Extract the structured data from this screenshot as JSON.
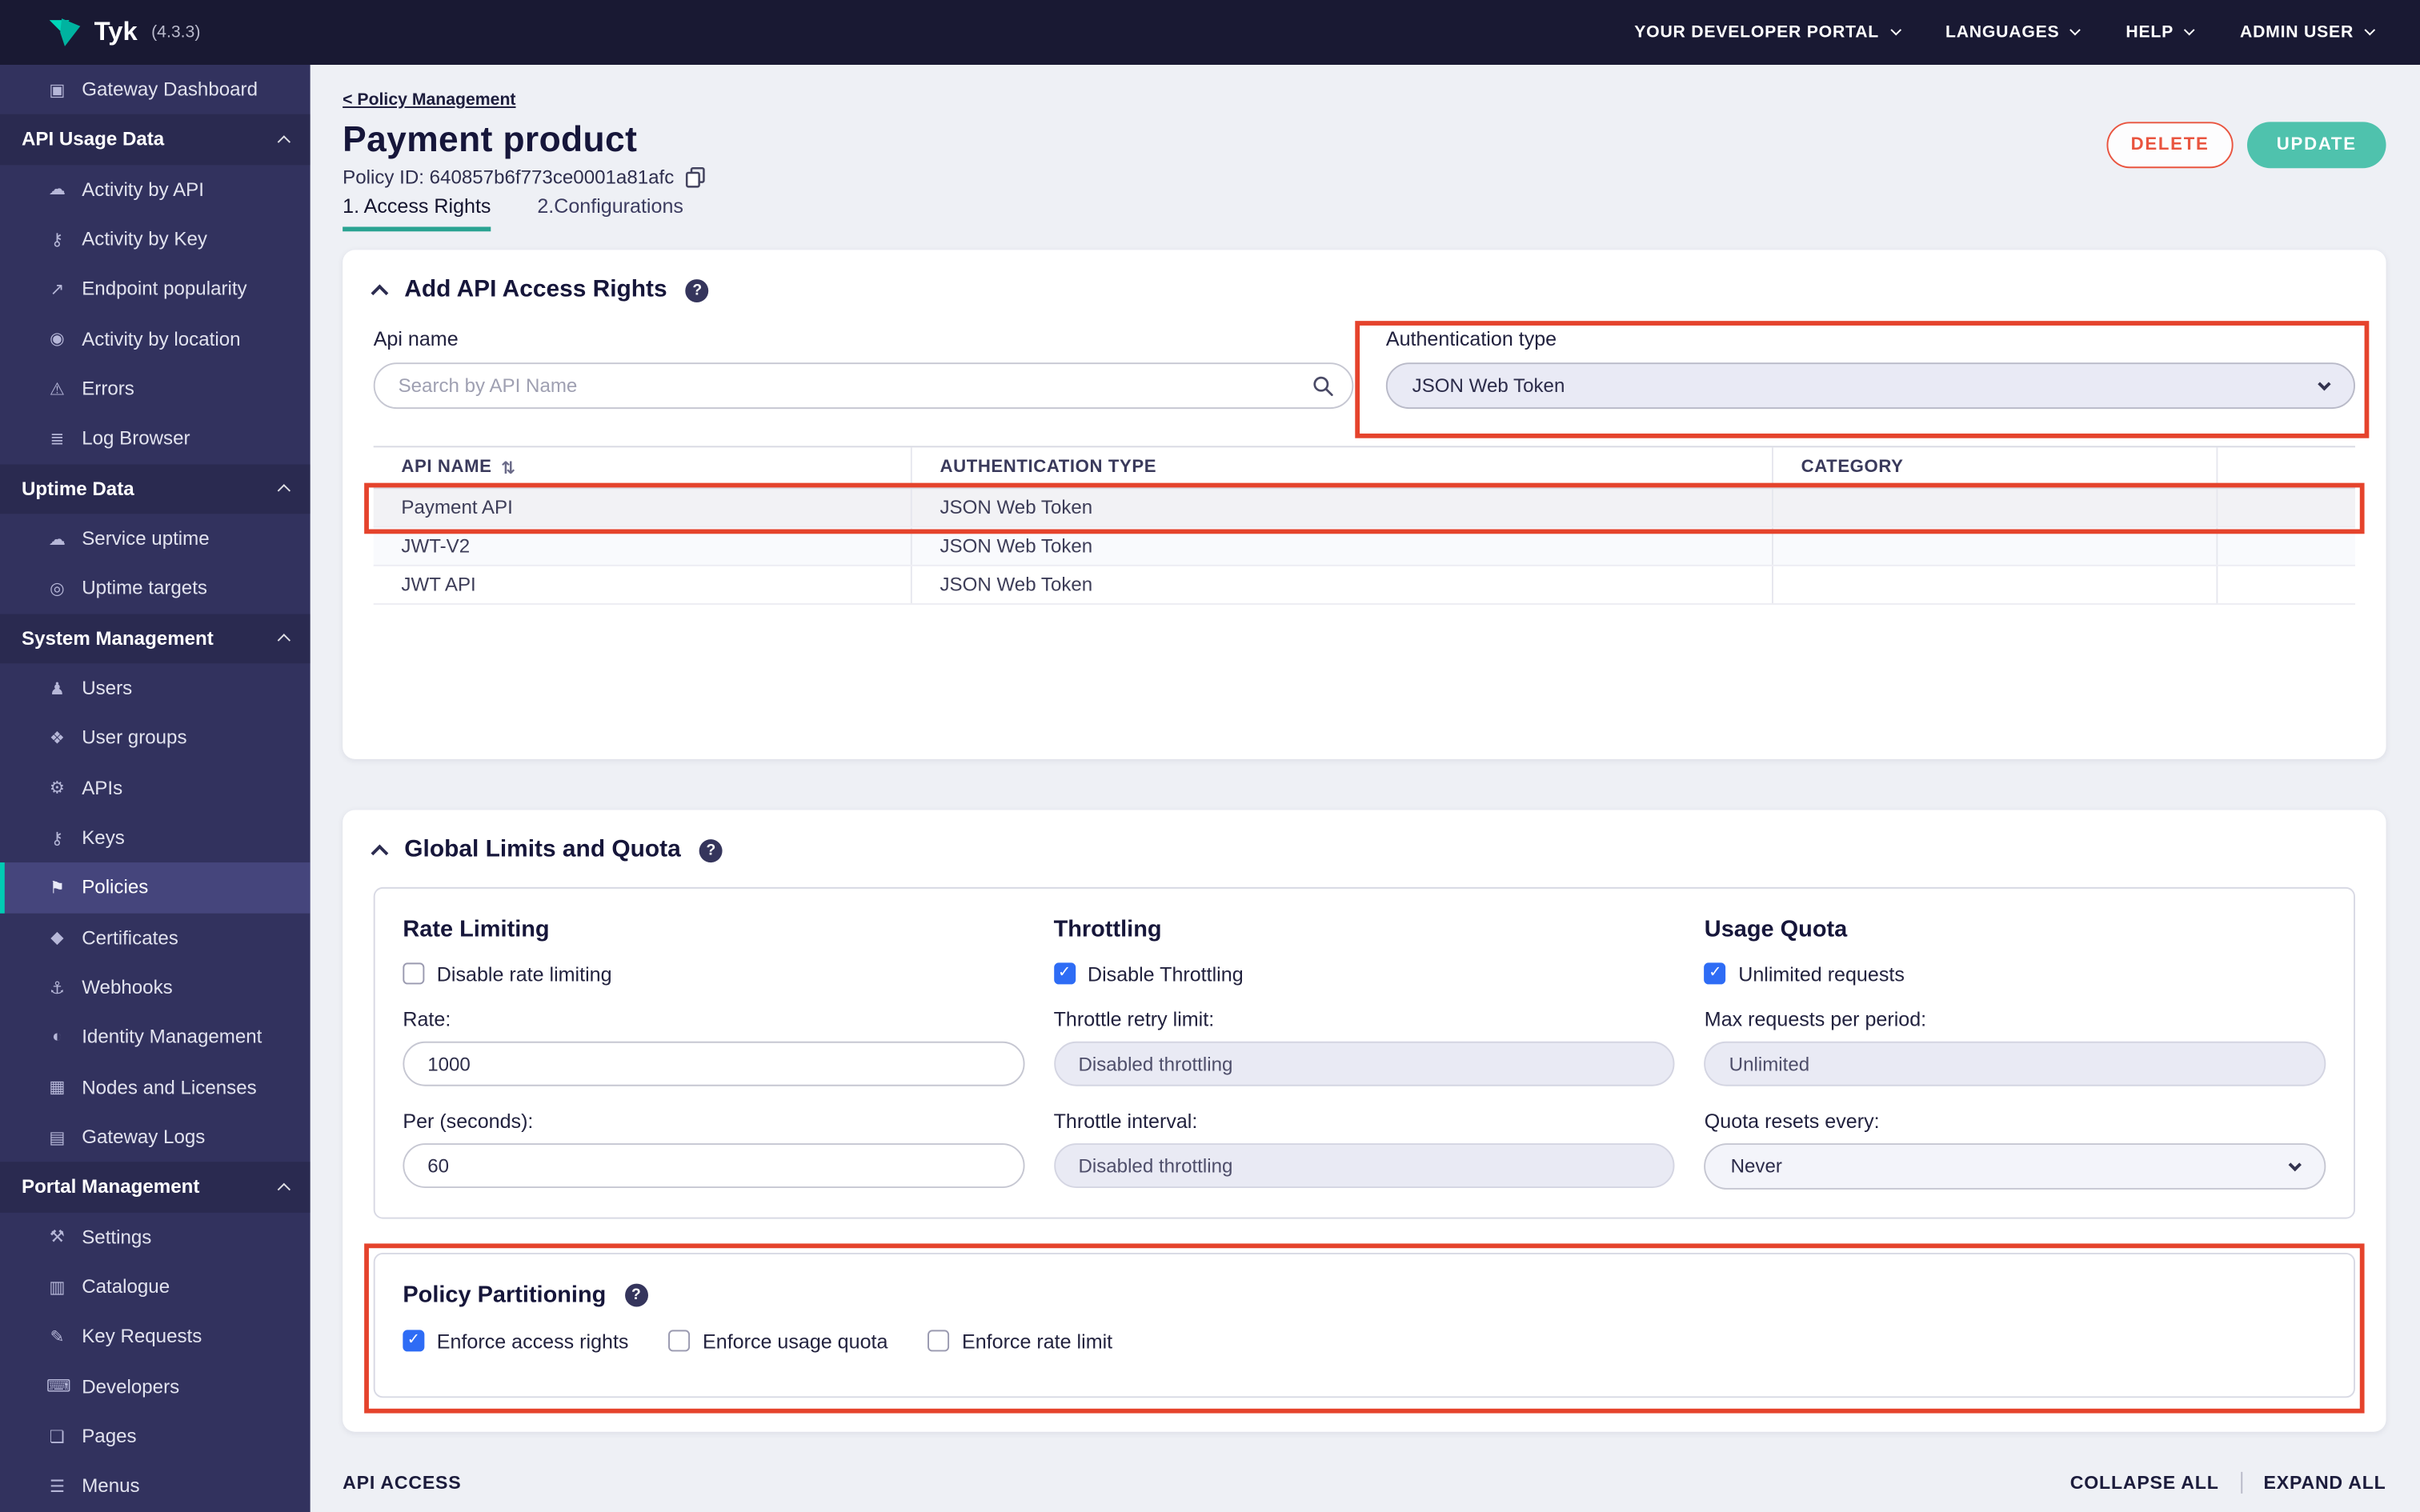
{
  "topbar": {
    "logo_text": "Tyk",
    "version": "(4.3.3)",
    "menus": [
      {
        "label": "YOUR DEVELOPER PORTAL"
      },
      {
        "label": "LANGUAGES"
      },
      {
        "label": "HELP"
      },
      {
        "label": "ADMIN USER"
      }
    ]
  },
  "sidebar": {
    "items": [
      {
        "type": "link",
        "label": "Gateway Dashboard",
        "icon": "gateway-dashboard-icon",
        "glyph": "▣"
      },
      {
        "type": "header",
        "label": "API Usage Data"
      },
      {
        "type": "link",
        "label": "Activity by API",
        "icon": "activity-by-api-icon",
        "glyph": "☁"
      },
      {
        "type": "link",
        "label": "Activity by Key",
        "icon": "activity-by-key-icon",
        "glyph": "⚷"
      },
      {
        "type": "link",
        "label": "Endpoint popularity",
        "icon": "endpoint-popularity-icon",
        "glyph": "↗"
      },
      {
        "type": "link",
        "label": "Activity by location",
        "icon": "activity-by-location-icon",
        "glyph": "◉"
      },
      {
        "type": "link",
        "label": "Errors",
        "icon": "errors-icon",
        "glyph": "⚠"
      },
      {
        "type": "link",
        "label": "Log Browser",
        "icon": "log-browser-icon",
        "glyph": "≣"
      },
      {
        "type": "header",
        "label": "Uptime Data"
      },
      {
        "type": "link",
        "label": "Service uptime",
        "icon": "service-uptime-icon",
        "glyph": "☁"
      },
      {
        "type": "link",
        "label": "Uptime targets",
        "icon": "uptime-targets-icon",
        "glyph": "◎"
      },
      {
        "type": "header",
        "label": "System Management"
      },
      {
        "type": "link",
        "label": "Users",
        "icon": "users-icon",
        "glyph": "♟"
      },
      {
        "type": "link",
        "label": "User groups",
        "icon": "user-groups-icon",
        "glyph": "❖"
      },
      {
        "type": "link",
        "label": "APIs",
        "icon": "apis-icon",
        "glyph": "⚙"
      },
      {
        "type": "link",
        "label": "Keys",
        "icon": "keys-icon",
        "glyph": "⚷"
      },
      {
        "type": "link",
        "label": "Policies",
        "icon": "policies-icon",
        "glyph": "⚑",
        "active": true
      },
      {
        "type": "link",
        "label": "Certificates",
        "icon": "certificates-icon",
        "glyph": "◆"
      },
      {
        "type": "link",
        "label": "Webhooks",
        "icon": "webhooks-icon",
        "glyph": "⚓"
      },
      {
        "type": "link",
        "label": "Identity Management",
        "icon": "identity-management-icon",
        "glyph": "◐"
      },
      {
        "type": "link",
        "label": "Nodes and Licenses",
        "icon": "nodes-and-licenses-icon",
        "glyph": "▦"
      },
      {
        "type": "link",
        "label": "Gateway Logs",
        "icon": "gateway-logs-icon",
        "glyph": "▤"
      },
      {
        "type": "header",
        "label": "Portal Management"
      },
      {
        "type": "link",
        "label": "Settings",
        "icon": "settings-icon",
        "glyph": "⚒"
      },
      {
        "type": "link",
        "label": "Catalogue",
        "icon": "catalogue-icon",
        "glyph": "▥"
      },
      {
        "type": "link",
        "label": "Key Requests",
        "icon": "key-requests-icon",
        "glyph": "✎"
      },
      {
        "type": "link",
        "label": "Developers",
        "icon": "developers-icon",
        "glyph": "⌨"
      },
      {
        "type": "link",
        "label": "Pages",
        "icon": "pages-icon",
        "glyph": "❏"
      },
      {
        "type": "link",
        "label": "Menus",
        "icon": "menus-icon",
        "glyph": "☰"
      }
    ]
  },
  "page": {
    "breadcrumb": "< Policy Management",
    "title": "Payment product",
    "policy_id": "Policy ID: 640857b6f773ce0001a81afc",
    "tabs": [
      {
        "label": "1. Access Rights",
        "active": true
      },
      {
        "label": "2.Configurations",
        "active": false
      }
    ],
    "delete_button": "DELETE",
    "update_button": "UPDATE"
  },
  "access_rights": {
    "section_title": "Add API Access Rights",
    "api_name_label": "Api name",
    "search_placeholder": "Search by API Name",
    "auth_type_label": "Authentication type",
    "auth_type_value": "JSON Web Token",
    "table": {
      "columns": [
        "API NAME",
        "AUTHENTICATION TYPE",
        "CATEGORY"
      ],
      "rows": [
        {
          "api_name": "Payment API",
          "auth_type": "JSON Web Token",
          "category": ""
        },
        {
          "api_name": "JWT-V2",
          "auth_type": "JSON Web Token",
          "category": ""
        },
        {
          "api_name": "JWT API",
          "auth_type": "JSON Web Token",
          "category": ""
        }
      ]
    }
  },
  "global_limits": {
    "section_title": "Global Limits and Quota",
    "rate_limiting": {
      "title": "Rate Limiting",
      "disable_label": "Disable rate limiting",
      "disable_checked": false,
      "rate_label": "Rate:",
      "rate_value": "1000",
      "per_label": "Per (seconds):",
      "per_value": "60"
    },
    "throttling": {
      "title": "Throttling",
      "disable_label": "Disable Throttling",
      "disable_checked": true,
      "retry_label": "Throttle retry limit:",
      "retry_value": "Disabled throttling",
      "interval_label": "Throttle interval:",
      "interval_value": "Disabled throttling"
    },
    "usage_quota": {
      "title": "Usage Quota",
      "unlimited_label": "Unlimited requests",
      "unlimited_checked": true,
      "max_label": "Max requests per period:",
      "max_value": "Unlimited",
      "resets_label": "Quota resets every:",
      "resets_value": "Never"
    }
  },
  "policy_partitioning": {
    "title": "Policy Partitioning",
    "options": [
      {
        "label": "Enforce access rights",
        "checked": true
      },
      {
        "label": "Enforce usage quota",
        "checked": false
      },
      {
        "label": "Enforce rate limit",
        "checked": false
      }
    ]
  },
  "footer": {
    "left": "API ACCESS",
    "collapse_all": "COLLAPSE ALL",
    "expand_all": "EXPAND ALL"
  },
  "glyphs": {
    "question": "?",
    "sort": "⇅",
    "check": "✓"
  },
  "colors": {
    "topbar_bg": "#191933",
    "sidebar_bg": "#32325e",
    "logo_teal": "#00ccb3",
    "accent_teal": "#4fc2ad",
    "tab_underline": "#2aa392",
    "delete_red": "#e9543f",
    "checkbox_blue": "#2e6cf5",
    "annotation_red": "#e5432c"
  }
}
